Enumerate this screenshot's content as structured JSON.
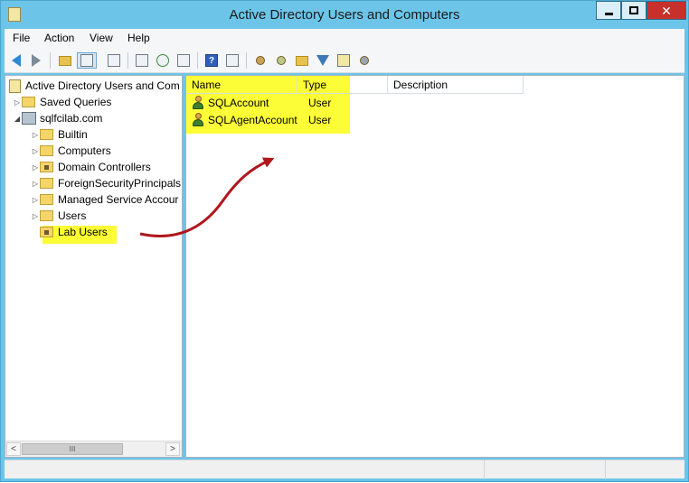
{
  "window": {
    "title": "Active Directory Users and Computers",
    "close_glyph": "✕"
  },
  "menu": {
    "items": [
      {
        "label": "File"
      },
      {
        "label": "Action"
      },
      {
        "label": "View"
      },
      {
        "label": "Help"
      }
    ]
  },
  "toolbar": {
    "icons": [
      "back-icon",
      "forward-icon",
      "up-folder-icon",
      "show-tree-icon",
      "properties-icon",
      "export-list-icon",
      "refresh-icon",
      "export-icon",
      "help-icon",
      "action-pane-icon",
      "new-user-icon",
      "new-group-icon",
      "new-ou-icon",
      "filter-icon",
      "find-icon",
      "add-to-group-icon"
    ],
    "help_glyph": "?"
  },
  "tree": {
    "root_label": "Active Directory Users and Com",
    "saved_queries": "Saved Queries",
    "domain": "sqlfcilab.com",
    "children": [
      {
        "label": "Builtin"
      },
      {
        "label": "Computers"
      },
      {
        "label": "Domain Controllers"
      },
      {
        "label": "ForeignSecurityPrincipals"
      },
      {
        "label": "Managed Service Accour"
      },
      {
        "label": "Users"
      },
      {
        "label": "Lab Users"
      }
    ],
    "scroll_left": "<",
    "scroll_right": ">",
    "scroll_grip": "III"
  },
  "list": {
    "columns": [
      {
        "label": "Name"
      },
      {
        "label": "Type"
      },
      {
        "label": "Description"
      }
    ],
    "rows": [
      {
        "name": "SQLAccount",
        "type": "User",
        "description": ""
      },
      {
        "name": "SQLAgentAccount",
        "type": "User",
        "description": ""
      }
    ]
  },
  "colors": {
    "titlebar": "#6cc5e9",
    "highlight": "#fdfd37",
    "annotation_arrow": "#b0161c",
    "close_button": "#c7302b"
  }
}
